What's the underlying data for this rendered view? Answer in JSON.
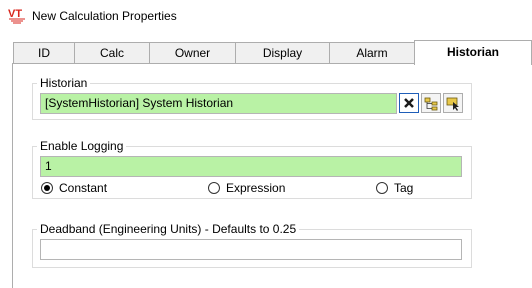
{
  "window": {
    "app_icon_text": "VT",
    "title": "New Calculation Properties"
  },
  "tabs": [
    {
      "label": "ID"
    },
    {
      "label": "Calc"
    },
    {
      "label": "Owner"
    },
    {
      "label": "Display"
    },
    {
      "label": "Alarm"
    },
    {
      "label": "Historian",
      "active": true
    }
  ],
  "historian": {
    "group_label": "Historian",
    "value": "[SystemHistorian]    System Historian",
    "buttons": [
      "clear-icon",
      "browse-tree-icon",
      "select-pointer-icon"
    ]
  },
  "logging": {
    "group_label": "Enable Logging",
    "value": "1",
    "options": [
      {
        "label": "Constant",
        "selected": true
      },
      {
        "label": "Expression",
        "selected": false
      },
      {
        "label": "Tag",
        "selected": false
      }
    ]
  },
  "deadband": {
    "group_label": "Deadband (Engineering Units) - Defaults to 0.25",
    "value": ""
  },
  "colors": {
    "field_green": "#b9f2a5",
    "brand_red": "#d9261c",
    "focus_blue": "#1f5eb8"
  }
}
